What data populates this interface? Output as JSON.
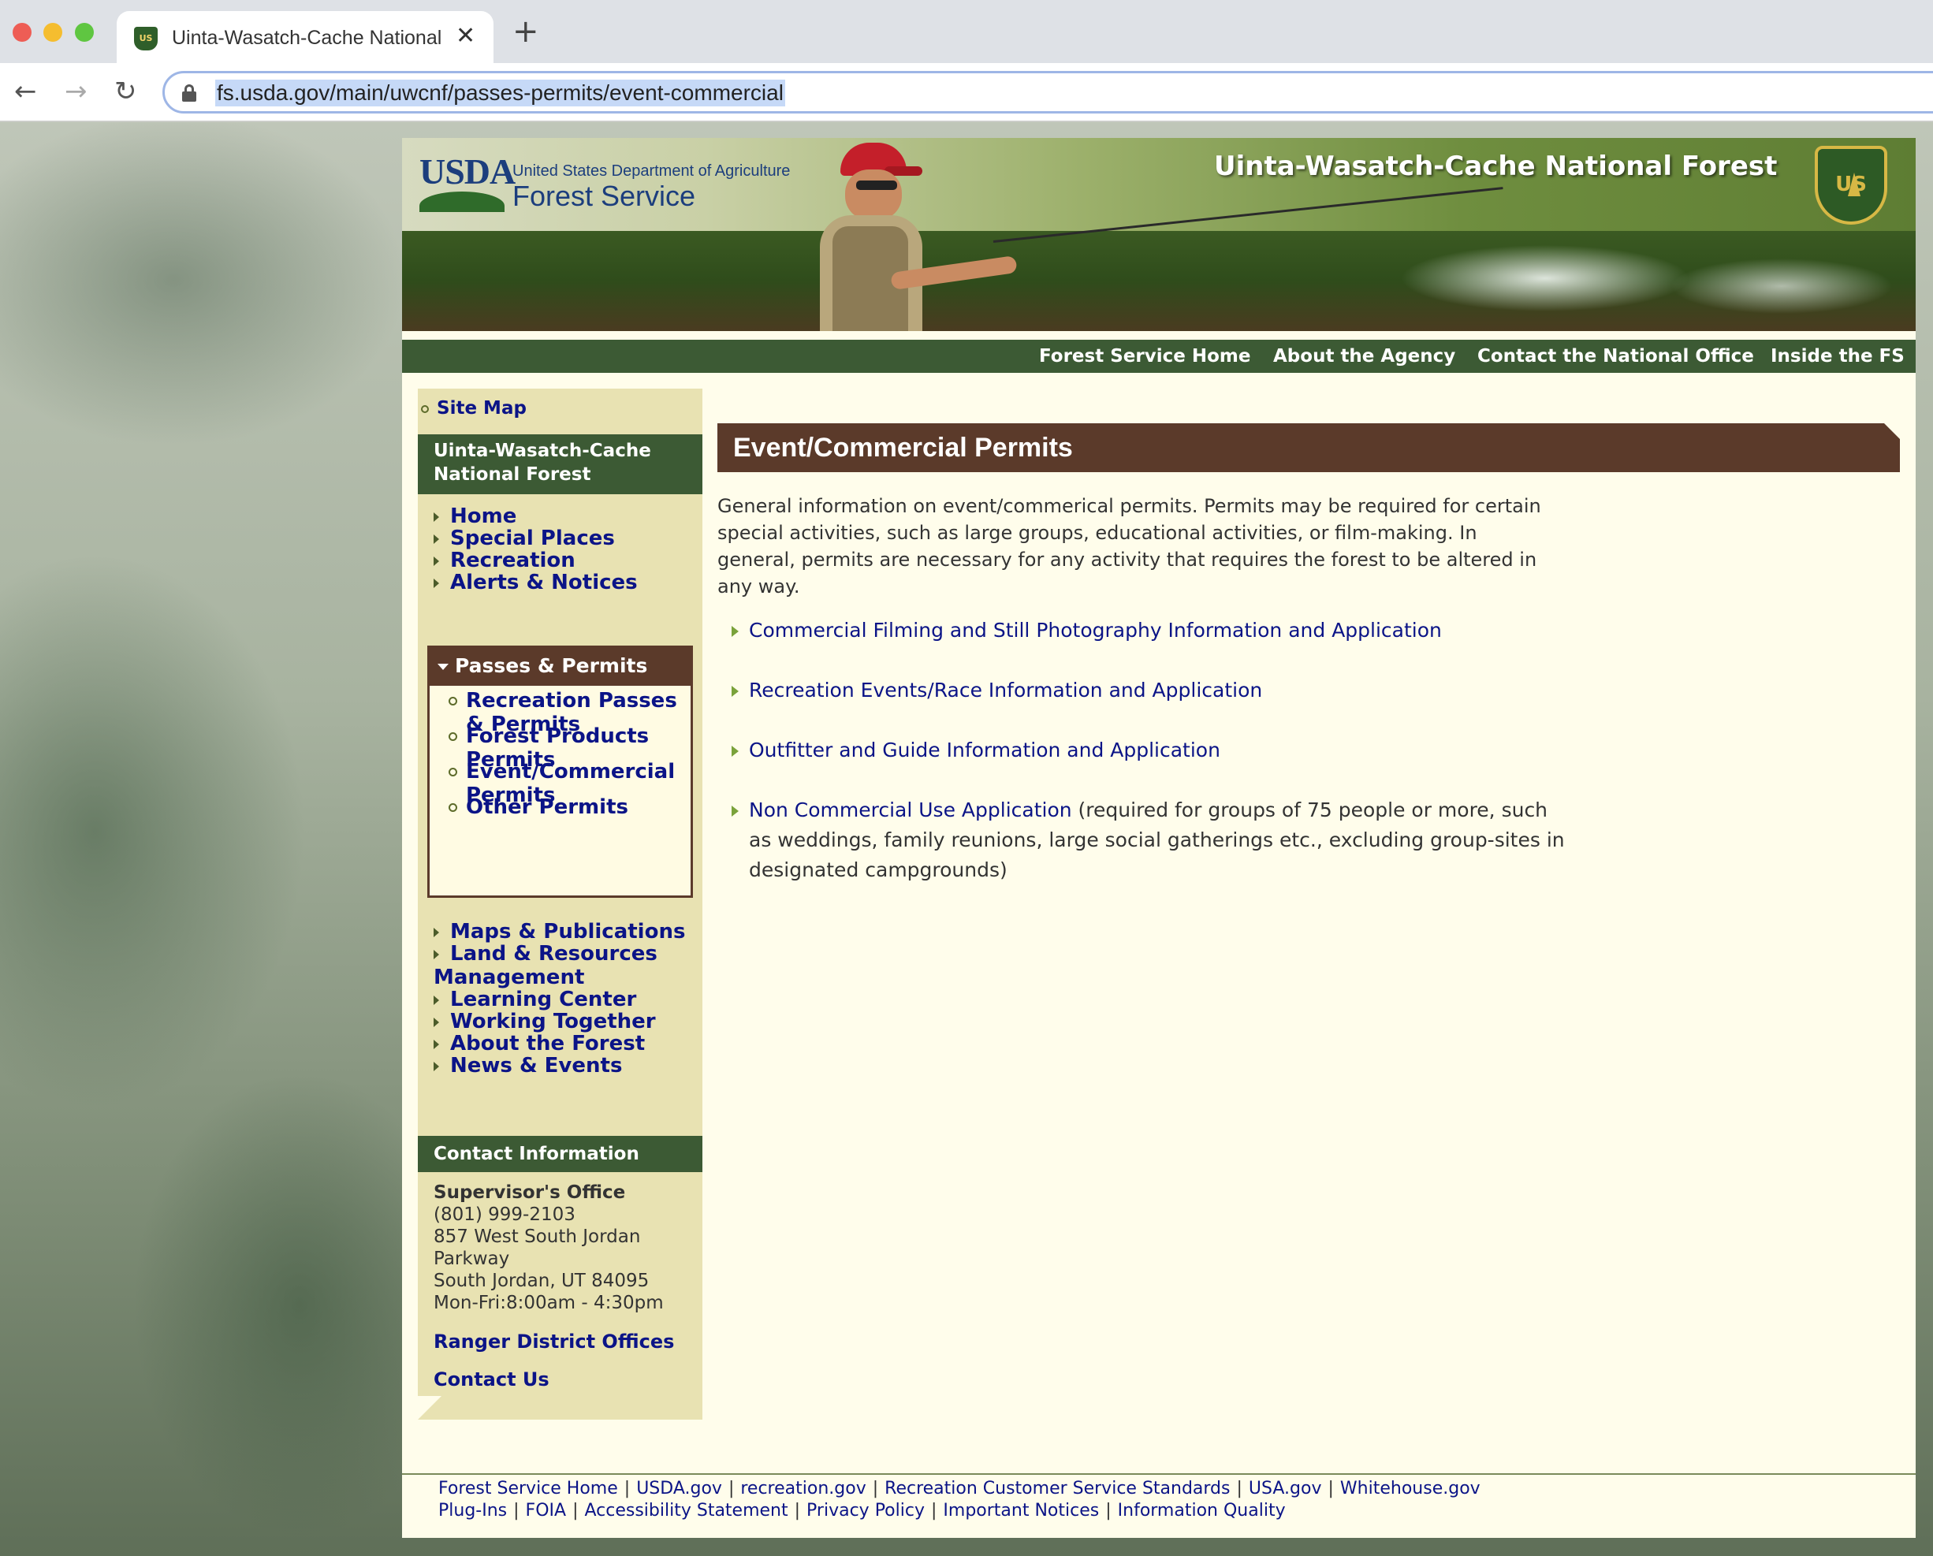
{
  "browser": {
    "tab_title": "Uinta-Wasatch-Cache National Forest",
    "close_glyph": "✕",
    "new_tab_glyph": "+",
    "url": "fs.usda.gov/main/uwcnf/passes-permits/event-commercial",
    "back_glyph": "←",
    "forward_glyph": "→",
    "reload_glyph": "↻"
  },
  "banner": {
    "usda_letters": "USDA",
    "dept": "United States Department of Agriculture",
    "agency": "Forest Service",
    "forest_name": "Uinta-Wasatch-Cache National Forest",
    "shield_letters": "US"
  },
  "topnav": [
    {
      "label": "Forest Service Home"
    },
    {
      "label": "About the Agency"
    },
    {
      "label": "Contact the National Office"
    },
    {
      "label": "Inside the FS"
    }
  ],
  "sidebar": {
    "site_map": "Site Map",
    "header": "Uinta-Wasatch-Cache National Forest",
    "items_top": [
      {
        "label": "Home"
      },
      {
        "label": "Special Places"
      },
      {
        "label": "Recreation"
      },
      {
        "label": "Alerts & Notices"
      }
    ],
    "expanded": {
      "label": "Passes & Permits",
      "children": [
        {
          "label": "Recreation Passes & Permits"
        },
        {
          "label": "Forest Products Permits"
        },
        {
          "label": "Event/Commercial Permits"
        },
        {
          "label": "Other Permits"
        }
      ]
    },
    "items_bottom": [
      {
        "label": "Maps & Publications"
      },
      {
        "label": "Land & Resources Management"
      },
      {
        "label": "Learning Center"
      },
      {
        "label": "Working Together"
      },
      {
        "label": "About the Forest"
      },
      {
        "label": "News & Events"
      }
    ],
    "contact": {
      "header": "Contact Information",
      "office": "Supervisor's Office",
      "phone": "(801) 999-2103",
      "address1": "857 West South Jordan",
      "address2": "Parkway",
      "city": "South Jordan, UT  84095",
      "hours": "Mon-Fri:8:00am - 4:30pm",
      "ranger_link": "Ranger District Offices",
      "contact_link": "Contact Us"
    }
  },
  "main": {
    "title": "Event/Commercial Permits",
    "intro": "General information on event/commerical permits. Permits may be required for certain special activities, such as large groups, educational activities, or film-making. In general, permits are necessary for any activity that requires the forest to be altered in any way.",
    "links": [
      {
        "label": "Commercial Filming and Still Photography Information and Application",
        "note": ""
      },
      {
        "label": "Recreation Events/Race Information and Application",
        "note": ""
      },
      {
        "label": "Outfitter and Guide Information and  Application",
        "note": ""
      },
      {
        "label": "Non Commercial Use Application",
        "note": " (required for groups of 75 people or more, such as weddings, family reunions, large social gatherings etc., excluding group-sites in designated campgrounds)"
      }
    ]
  },
  "footer": {
    "row1": [
      {
        "label": "Forest Service Home"
      },
      {
        "label": "USDA.gov"
      },
      {
        "label": "recreation.gov"
      },
      {
        "label": "Recreation Customer Service Standards"
      },
      {
        "label": "USA.gov"
      },
      {
        "label": "Whitehouse.gov"
      }
    ],
    "row2": [
      {
        "label": "Plug-Ins"
      },
      {
        "label": "FOIA"
      },
      {
        "label": "Accessibility Statement"
      },
      {
        "label": "Privacy Policy"
      },
      {
        "label": "Important Notices"
      },
      {
        "label": "Information Quality"
      }
    ],
    "separator": "|"
  }
}
